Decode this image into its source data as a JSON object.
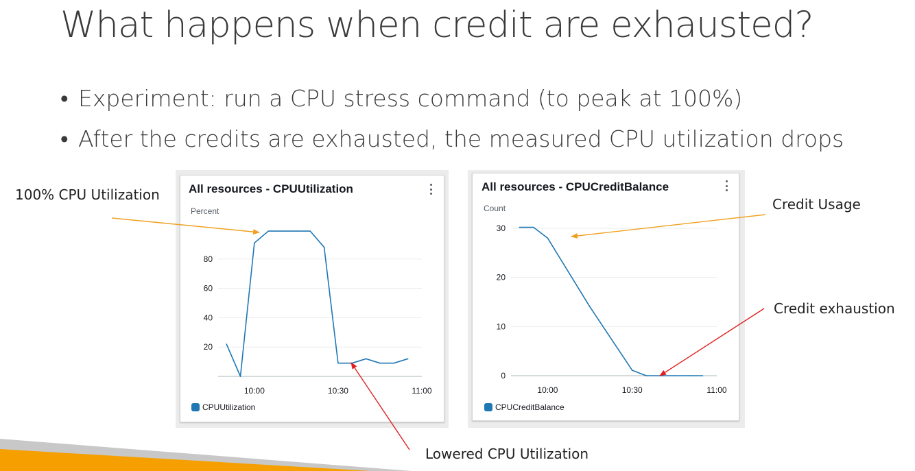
{
  "slide": {
    "title": "What happens when credit are exhausted?",
    "bullets": [
      "Experiment: run a CPU stress command (to peak at 100%)",
      "After the credits are exhausted, the measured CPU utilization drops"
    ]
  },
  "widgets": [
    {
      "title": "All resources - CPUUtilization",
      "unit": "Percent",
      "legend": "CPUUtilization"
    },
    {
      "title": "All resources - CPUCreditBalance",
      "unit": "Count",
      "legend": "CPUCreditBalance"
    }
  ],
  "annotations": {
    "cpu_peak": "100% CPU Utilization",
    "cpu_lowered": "Lowered CPU Utilization",
    "credit_usage": "Credit Usage",
    "credit_exhaustion": "Credit exhaustion"
  },
  "colors": {
    "series": "#1f77b4",
    "arrow_orange": "#f0a020",
    "arrow_red": "#e02020",
    "accent_orange": "#f39c12"
  },
  "chart_data": [
    {
      "type": "line",
      "title": "All resources - CPUUtilization",
      "ylabel": "Percent",
      "xlabel": "",
      "x_ticks": [
        "10:00",
        "10:30",
        "11:00"
      ],
      "y_ticks": [
        20,
        40,
        60,
        80
      ],
      "xlim": [
        "09:47",
        "11:00"
      ],
      "ylim": [
        0,
        100
      ],
      "grid": true,
      "legend_position": "bottom-left",
      "series": [
        {
          "name": "CPUUtilization",
          "x": [
            "09:50",
            "09:55",
            "10:00",
            "10:05",
            "10:10",
            "10:15",
            "10:20",
            "10:25",
            "10:30",
            "10:35",
            "10:40",
            "10:45",
            "10:50",
            "10:55"
          ],
          "y": [
            22,
            0,
            91,
            99,
            99,
            99,
            99,
            88,
            9,
            9,
            12,
            9,
            9,
            12
          ]
        }
      ]
    },
    {
      "type": "line",
      "title": "All resources - CPUCreditBalance",
      "ylabel": "Count",
      "xlabel": "",
      "x_ticks": [
        "10:00",
        "10:30",
        "11:00"
      ],
      "y_ticks": [
        0,
        10,
        20,
        30
      ],
      "xlim": [
        "09:47",
        "11:00"
      ],
      "ylim": [
        0,
        30
      ],
      "grid": true,
      "legend_position": "bottom-left",
      "series": [
        {
          "name": "CPUCreditBalance",
          "x": [
            "09:50",
            "09:55",
            "10:00",
            "10:15",
            "10:30",
            "10:35",
            "10:40",
            "10:45",
            "10:50",
            "10:55"
          ],
          "y": [
            30.2,
            30.2,
            28,
            14,
            1.1,
            0,
            0,
            0,
            0,
            0
          ]
        }
      ]
    }
  ]
}
